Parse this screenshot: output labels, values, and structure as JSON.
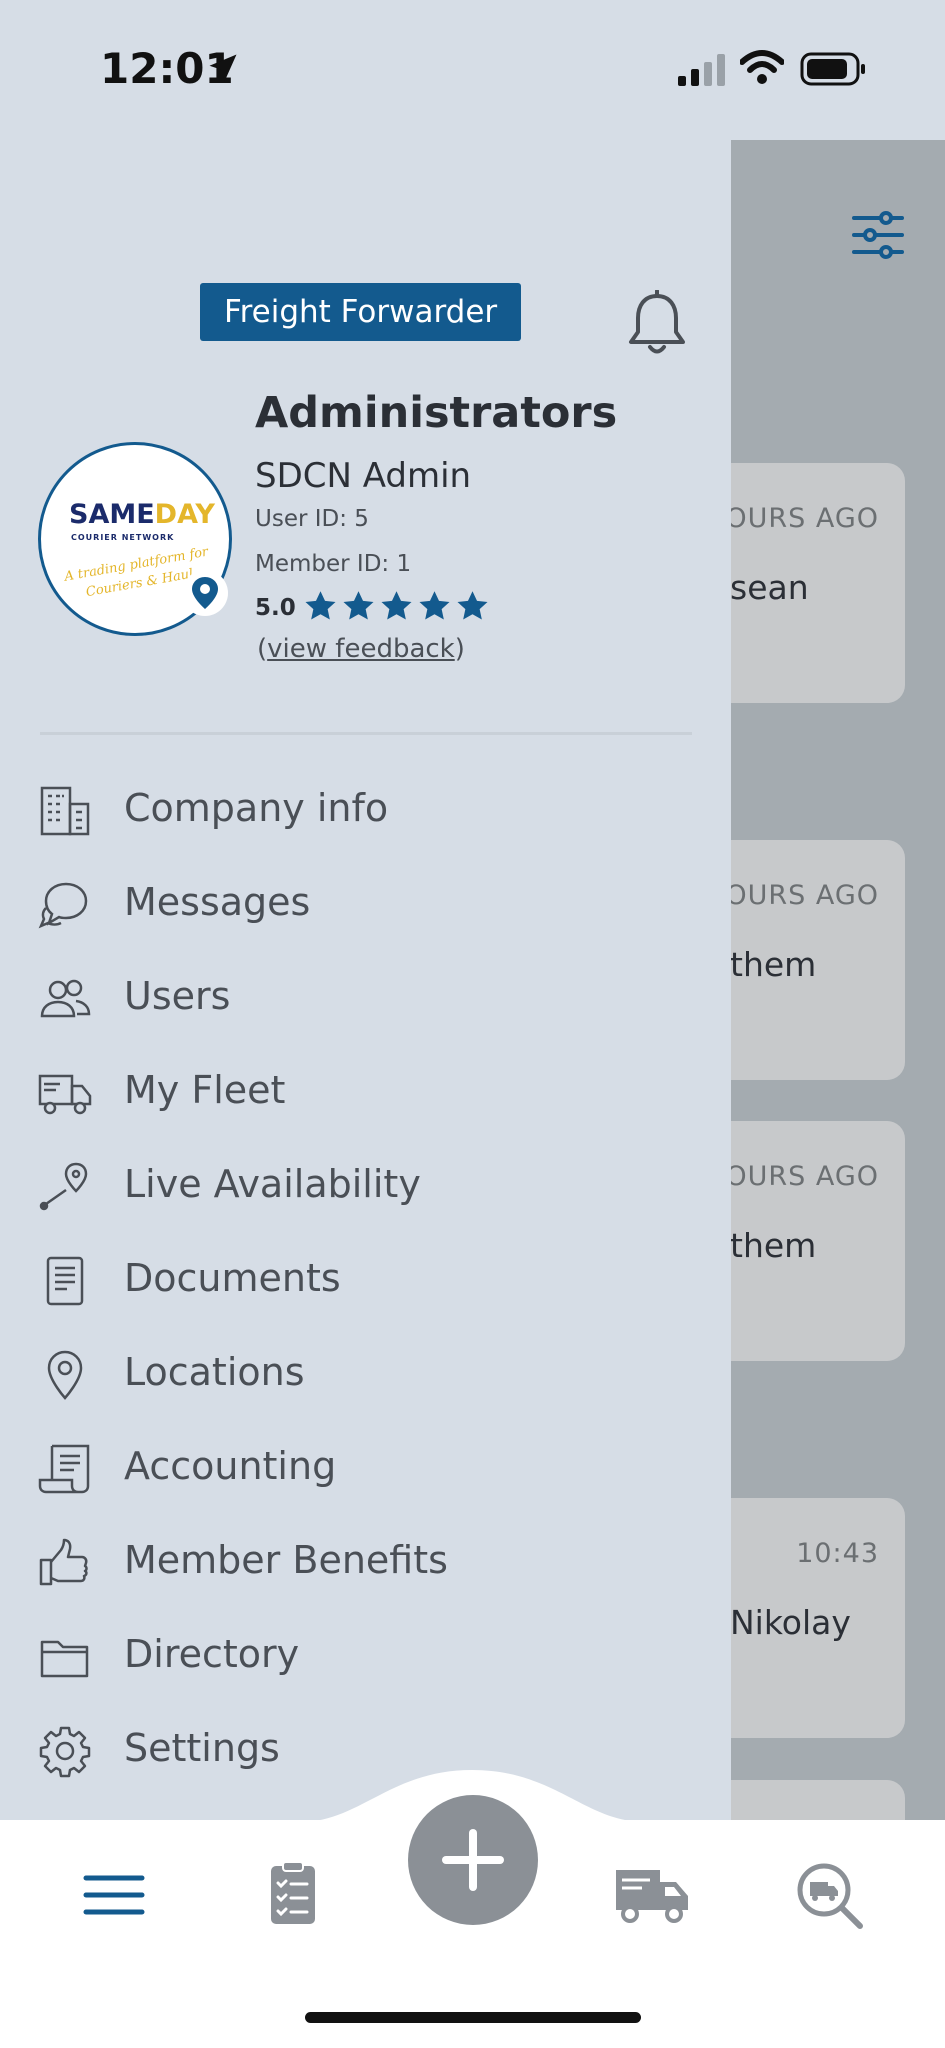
{
  "status_bar": {
    "time": "12:01"
  },
  "drawer": {
    "role_badge": "Freight Forwarder",
    "company_logo": {
      "brand_main": "SAME",
      "brand_accent": "DAY",
      "brand_sub": "COURIER NETWORK",
      "tagline": "A trading platform for Couriers & Haul"
    },
    "group_title": "Administrators",
    "user_name": "SDCN Admin",
    "user_id": "User ID: 5",
    "member_id": "Member ID: 1",
    "rating": "5.0",
    "rating_stars": 5,
    "feedback_open": "(",
    "feedback_link": "view feedback",
    "feedback_close": ")",
    "menu": [
      {
        "label": "Company info",
        "icon": "building-icon"
      },
      {
        "label": "Messages",
        "icon": "chat-icon"
      },
      {
        "label": "Users",
        "icon": "users-icon"
      },
      {
        "label": "My Fleet",
        "icon": "truck-icon"
      },
      {
        "label": "Live Availability",
        "icon": "route-pin-icon"
      },
      {
        "label": "Documents",
        "icon": "document-icon"
      },
      {
        "label": "Locations",
        "icon": "location-pin-icon"
      },
      {
        "label": "Accounting",
        "icon": "receipt-icon"
      },
      {
        "label": "Member Benefits",
        "icon": "thumbs-up-icon"
      },
      {
        "label": "Directory",
        "icon": "folder-icon"
      },
      {
        "label": "Settings",
        "icon": "gear-icon"
      }
    ]
  },
  "background_list": [
    {
      "ago": "OURS AGO",
      "who": "sean"
    },
    {
      "ago": "OURS AGO",
      "who": "them"
    },
    {
      "ago": "OURS AGO",
      "who": "them"
    },
    {
      "ago": "10:43",
      "who": "Nikolay"
    }
  ],
  "bottom_nav": {
    "items": [
      "menu-icon",
      "checklist-icon",
      "add-icon",
      "delivery-truck-icon",
      "search-truck-icon"
    ]
  },
  "colors": {
    "accent": "#135a8e",
    "drawer_bg": "#d6dde6",
    "text_muted": "#4a4f56",
    "fab": "#8b9096"
  }
}
